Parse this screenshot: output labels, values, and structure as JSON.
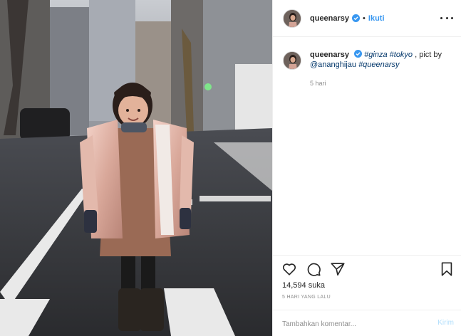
{
  "header": {
    "username": "queenarsy",
    "separator": "•",
    "follow_label": "Ikuti",
    "more_icon": "more-options-icon"
  },
  "caption": {
    "username": "queenarsy",
    "hashtag1": "#ginza",
    "hashtag2": "#tokyo",
    "text_mid": " , pict by",
    "mention": "@ananghijau",
    "hashtag3": "#queenarsy",
    "time": "5 hari"
  },
  "actions": {
    "icons": [
      "heart-icon",
      "comment-icon",
      "share-icon",
      "bookmark-icon"
    ],
    "likes": "14,594 suka",
    "posted_ago": "5 HARI YANG LALU"
  },
  "comment": {
    "placeholder": "Tambahkan komentar...",
    "post_label": "Kirim"
  },
  "colors": {
    "accent": "#3897f0",
    "link": "#003569",
    "muted": "#8e8e8e",
    "post_disabled": "#b2dffc"
  }
}
